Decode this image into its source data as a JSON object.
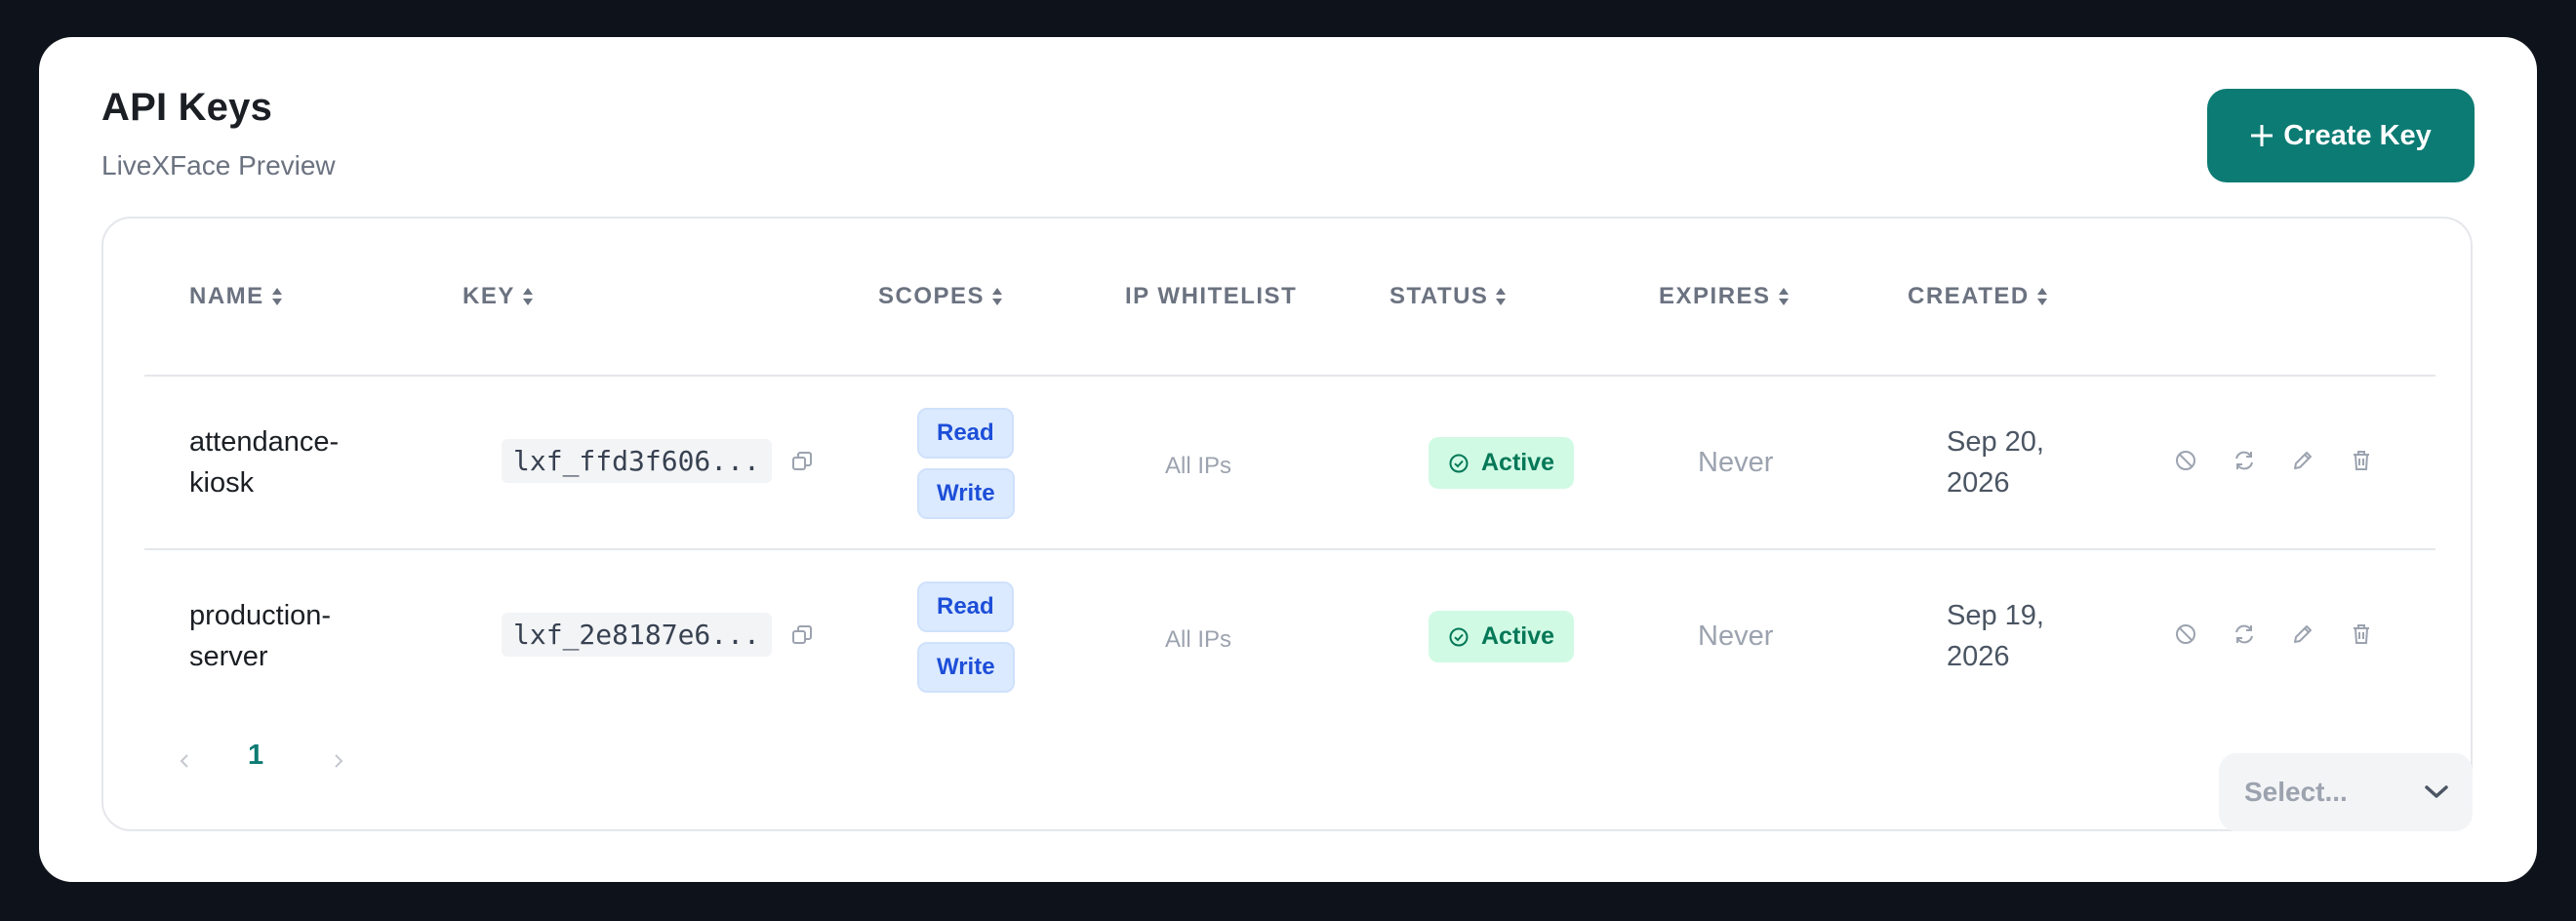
{
  "header": {
    "title": "API Keys",
    "subtitle": "LiveXFace Preview",
    "create_button_label": "Create Key"
  },
  "table": {
    "columns": {
      "name": "NAME",
      "key": "KEY",
      "scopes": "SCOPES",
      "ip_whitelist": "IP WHITELIST",
      "status": "STATUS",
      "expires": "EXPIRES",
      "created": "CREATED"
    },
    "rows": [
      {
        "name": "attendance-kiosk",
        "key": "lxf_ffd3f606...",
        "scopes": [
          "Read",
          "Write"
        ],
        "ip_whitelist": "All IPs",
        "status": "Active",
        "expires": "Never",
        "created": "Sep 20, 2026"
      },
      {
        "name": "production-server",
        "key": "lxf_2e8187e6...",
        "scopes": [
          "Read",
          "Write"
        ],
        "ip_whitelist": "All IPs",
        "status": "Active",
        "expires": "Never",
        "created": "Sep 19, 2026"
      }
    ]
  },
  "pagination": {
    "current_page": "1",
    "prev_icon": "chevron-left-icon",
    "next_icon": "chevron-right-icon",
    "page_size_placeholder": "Select..."
  },
  "colors": {
    "accent": "#0c7b73",
    "status_active_bg": "#d1fae5",
    "status_active_text": "#047857",
    "scope_bg": "#dbeafe",
    "scope_text": "#1d4ed8",
    "background": "#0e121a"
  },
  "icons": {
    "row_actions": [
      "disable-icon",
      "rotate-icon",
      "edit-icon",
      "delete-icon"
    ],
    "copy": "copy-icon",
    "status": "check-circle-icon",
    "sort": "sort-icon",
    "create": "plus-icon",
    "select": "chevron-down-icon"
  }
}
